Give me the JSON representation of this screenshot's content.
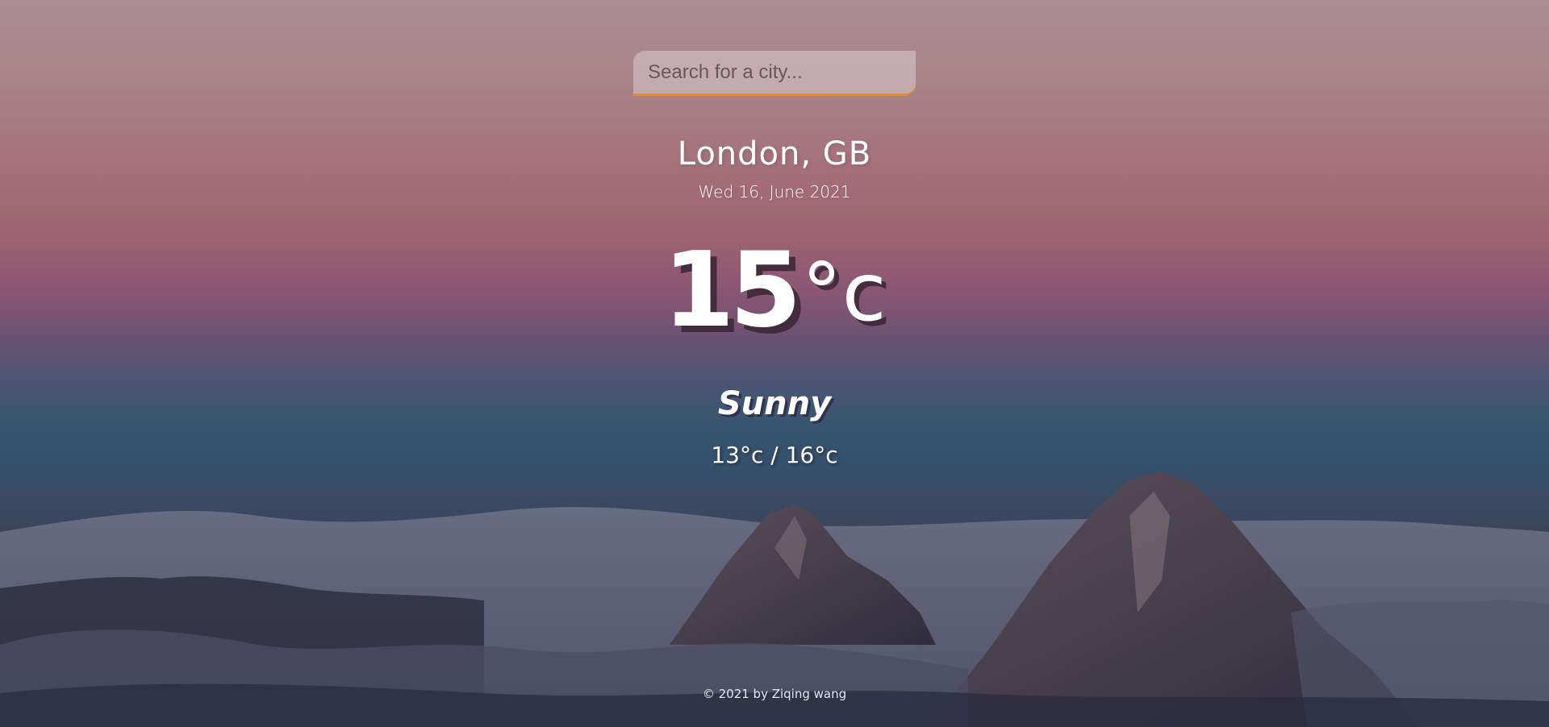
{
  "search": {
    "placeholder": "Search for a city...",
    "value": ""
  },
  "location": {
    "city": "London, GB",
    "date": "Wed 16, June 2021"
  },
  "weather": {
    "temperature": "15",
    "unit": "°c",
    "condition": "Sunny",
    "hi_low": "13°c / 16°c"
  },
  "footer": {
    "copyright": "© 2021 by Ziqing wang"
  },
  "colors": {
    "search_underline": "#df8e2f",
    "text": "#ffffff"
  },
  "icons": {
    "background": "mountain-cloud-scenery"
  }
}
